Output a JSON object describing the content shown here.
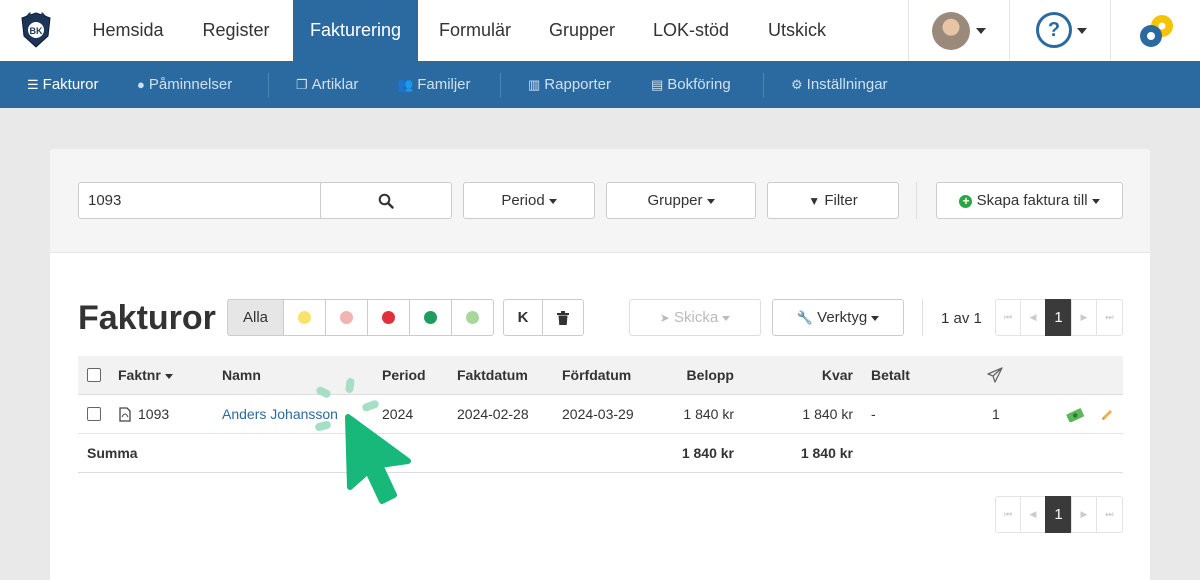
{
  "topnav": {
    "items": [
      {
        "label": "Hemsida"
      },
      {
        "label": "Register"
      },
      {
        "label": "Fakturering",
        "active": true
      },
      {
        "label": "Formulär"
      },
      {
        "label": "Grupper"
      },
      {
        "label": "LOK-stöd"
      },
      {
        "label": "Utskick"
      }
    ],
    "logo_text": "BK",
    "help_label": "?"
  },
  "subnav": {
    "items": [
      {
        "label": "Fakturor",
        "icon": "list-icon",
        "active": true
      },
      {
        "label": "Påminnelser",
        "icon": "exclamation-circle-icon"
      },
      {
        "label": "Artiklar",
        "icon": "copy-icon"
      },
      {
        "label": "Familjer",
        "icon": "users-icon"
      },
      {
        "label": "Rapporter",
        "icon": "bar-chart-icon"
      },
      {
        "label": "Bokföring",
        "icon": "book-icon"
      },
      {
        "label": "Inställningar",
        "icon": "gear-icon"
      }
    ]
  },
  "toolbar": {
    "search_value": "1093",
    "period_label": "Period",
    "groups_label": "Grupper",
    "filter_label": "Filter",
    "create_label": "Skapa faktura till"
  },
  "invoices": {
    "title": "Fakturor",
    "status_all_label": "Alla",
    "status_colors": [
      "#f7e36b",
      "#f2b3b3",
      "#e0303b",
      "#1f9d60",
      "#a9d79b"
    ],
    "k_label": "K",
    "send_label": "Skicka",
    "tools_label": "Verktyg",
    "pager_text": "1 av 1",
    "current_page": "1",
    "columns": {
      "faktnr": "Faktnr",
      "namn": "Namn",
      "period": "Period",
      "faktdatum": "Faktdatum",
      "forfdatum": "Förfdatum",
      "belopp": "Belopp",
      "kvar": "Kvar",
      "betalt": "Betalt"
    },
    "rows": [
      {
        "faktnr": "1093",
        "namn": "Anders Johansson",
        "period": "2024",
        "faktdatum": "2024-02-28",
        "forfdatum": "2024-03-29",
        "belopp": "1 840 kr",
        "kvar": "1 840 kr",
        "betalt": "-",
        "sent": "1"
      }
    ],
    "summary": {
      "label": "Summa",
      "belopp": "1 840 kr",
      "kvar": "1 840 kr"
    }
  },
  "colors": {
    "primary": "#2b6aa1",
    "cursor": "#17b879"
  }
}
